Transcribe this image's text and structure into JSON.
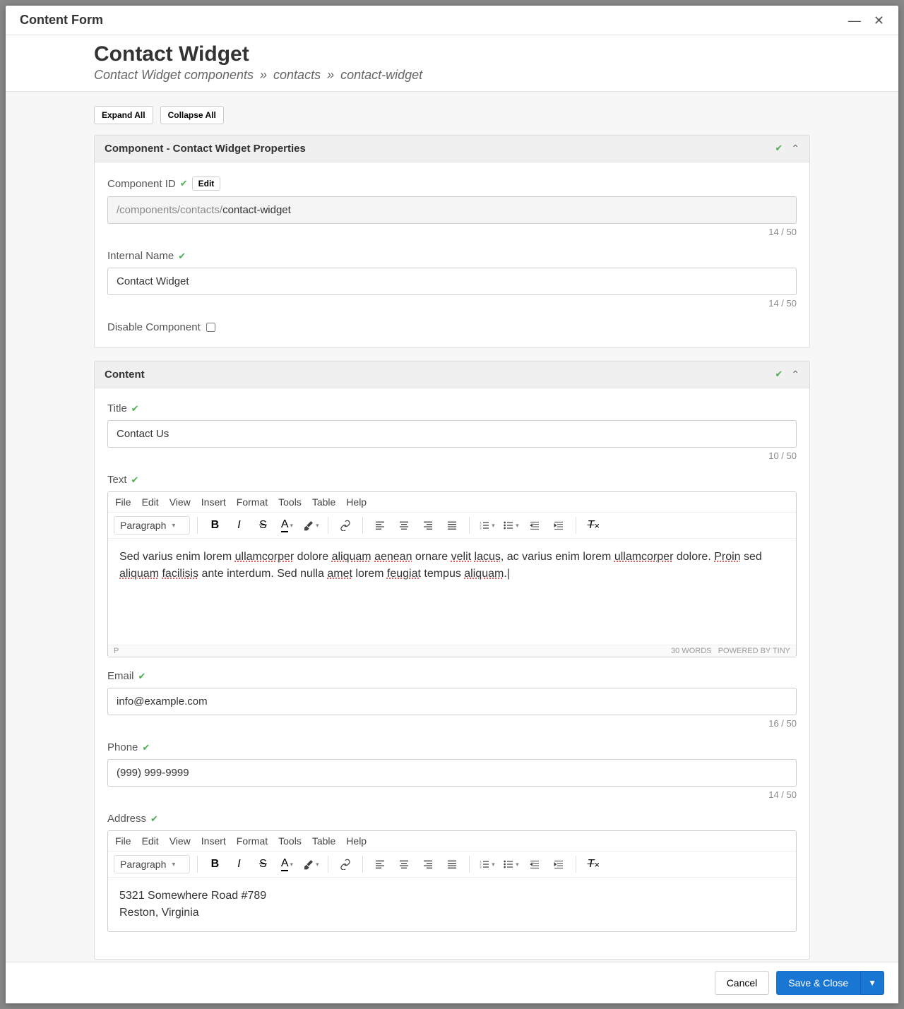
{
  "modal": {
    "title": "Content Form"
  },
  "page": {
    "title": "Contact Widget",
    "breadcrumb": [
      "Contact Widget",
      "components",
      "contacts",
      "contact-widget"
    ]
  },
  "expand": {
    "expand_all": "Expand All",
    "collapse_all": "Collapse All"
  },
  "sections": {
    "properties": {
      "title": "Component - Contact Widget Properties",
      "fields": {
        "component_id": {
          "label": "Component ID",
          "edit": "Edit",
          "prefix": "/components/contacts/",
          "value": "contact-widget",
          "counter": "14 / 50"
        },
        "internal_name": {
          "label": "Internal Name",
          "value": "Contact Widget",
          "counter": "14 / 50"
        },
        "disable": {
          "label": "Disable Component"
        }
      }
    },
    "content": {
      "title": "Content",
      "fields": {
        "title": {
          "label": "Title",
          "value": "Contact Us",
          "counter": "10 / 50"
        },
        "text": {
          "label": "Text",
          "body_plain": "Sed varius enim lorem ullamcorper dolore aliquam aenean ornare velit lacus, ac varius enim lorem ullamcorper dolore. Proin sed aliquam facilisis ante interdum. Sed nulla amet lorem feugiat tempus aliquam.",
          "spellcheck_words": [
            "ullamcorper",
            "aliquam",
            "aenean",
            "velit",
            "lacus",
            "ullamcorper",
            "Proin",
            "aliquam",
            "facilisis",
            "amet",
            "feugiat",
            "aliquam"
          ],
          "word_count": "30 WORDS",
          "powered": "POWERED BY TINY",
          "path": "P"
        },
        "email": {
          "label": "Email",
          "value": "info@example.com",
          "counter": "16 / 50"
        },
        "phone": {
          "label": "Phone",
          "value": "(999) 999-9999",
          "counter": "14 / 50"
        },
        "address": {
          "label": "Address",
          "line1": "5321 Somewhere Road #789",
          "line2": "Reston, Virginia"
        }
      }
    }
  },
  "rte": {
    "menubar": [
      "File",
      "Edit",
      "View",
      "Insert",
      "Format",
      "Tools",
      "Table",
      "Help"
    ],
    "paragraph": "Paragraph"
  },
  "footer": {
    "cancel": "Cancel",
    "save": "Save & Close"
  }
}
